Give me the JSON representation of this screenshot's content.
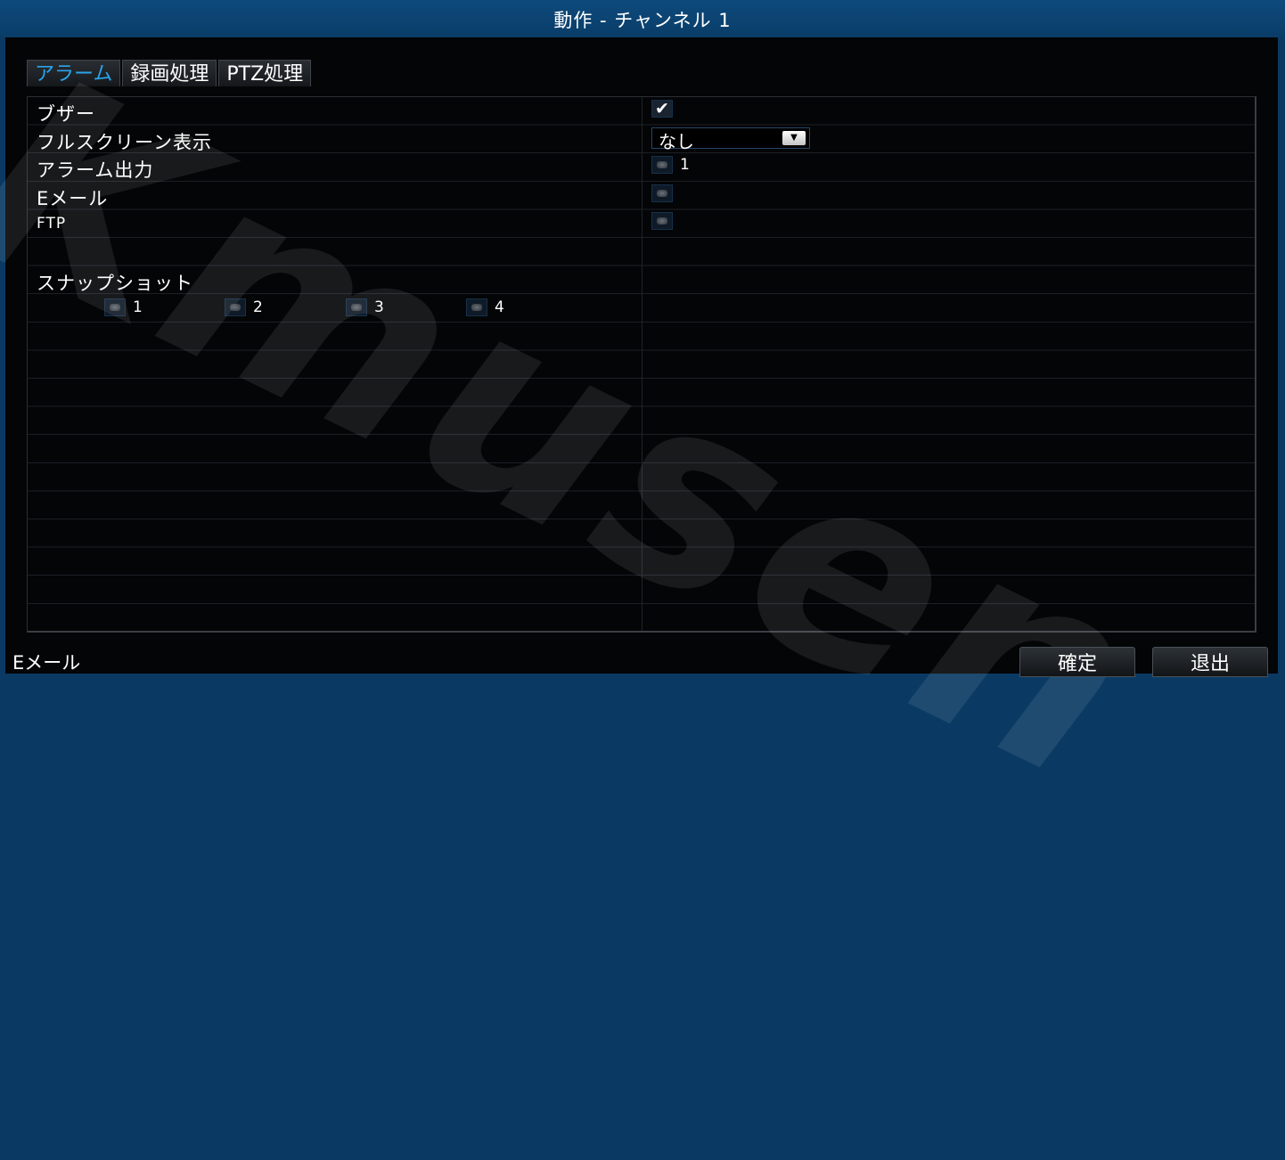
{
  "window": {
    "title": "動作 - チャンネル 1"
  },
  "tabs": [
    {
      "label": "アラーム",
      "active": true
    },
    {
      "label": "録画処理",
      "active": false
    },
    {
      "label": "PTZ処理",
      "active": false
    }
  ],
  "settings": {
    "buzzer": {
      "label": "ブザー",
      "checked": true
    },
    "fullscreen": {
      "label": "フルスクリーン表示",
      "value": "なし"
    },
    "alarm_output": {
      "label": "アラーム出力",
      "option_label": "1",
      "checked": false
    },
    "email": {
      "label": "Eメール",
      "checked": false
    },
    "ftp": {
      "label": "FTP",
      "checked": false
    },
    "snapshot": {
      "label": "スナップショット",
      "channels": [
        {
          "label": "1",
          "checked": false
        },
        {
          "label": "2",
          "checked": false
        },
        {
          "label": "3",
          "checked": false
        },
        {
          "label": "4",
          "checked": false
        }
      ]
    }
  },
  "footer": {
    "status_text": "Eメール",
    "ok_label": "確定",
    "exit_label": "退出"
  },
  "watermark": {
    "text": "Kmusen"
  },
  "colors": {
    "title_bar": "#0a3d68",
    "active_tab": "#2aa4ea",
    "panel_bg": "#040506"
  }
}
